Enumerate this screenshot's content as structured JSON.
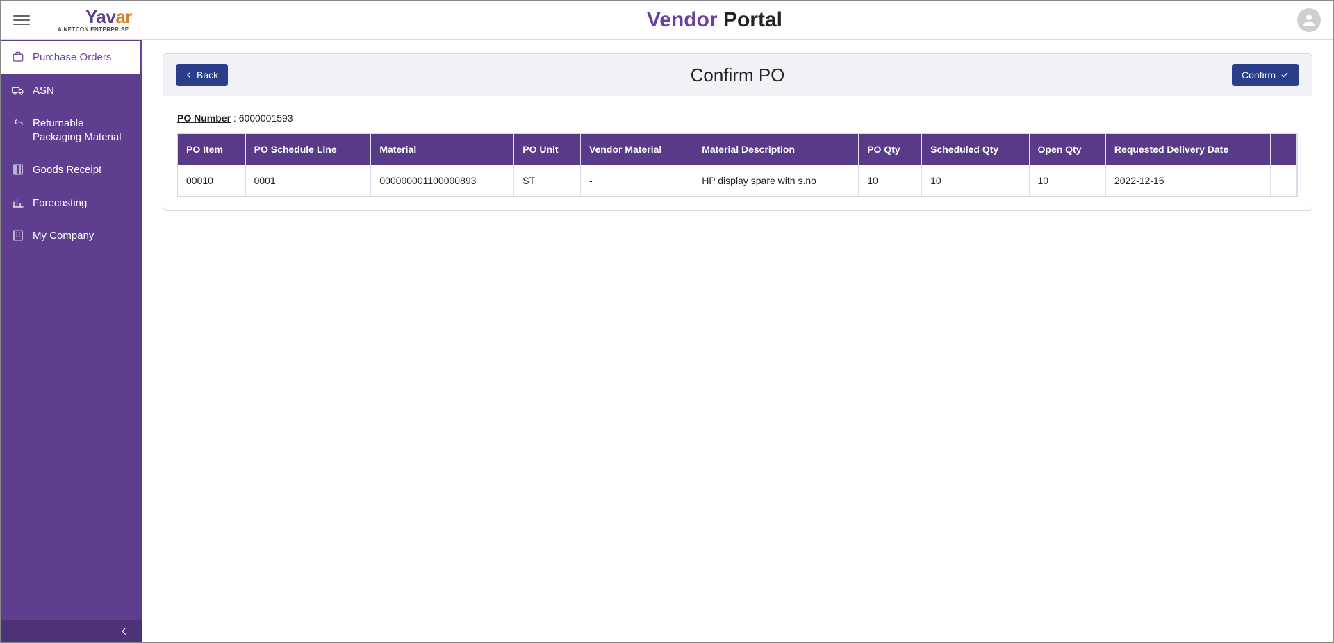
{
  "header": {
    "logo_main": "Yavar",
    "logo_sub": "A NETCON ENTERPRISE",
    "title_accent": "Vendor",
    "title_plain": "Portal"
  },
  "sidebar": {
    "items": [
      {
        "label": "Purchase Orders",
        "icon": "briefcase-icon",
        "active": true
      },
      {
        "label": "ASN",
        "icon": "truck-icon",
        "active": false
      },
      {
        "label": "Returnable Packaging Material",
        "icon": "return-icon",
        "active": false
      },
      {
        "label": "Goods Receipt",
        "icon": "receipt-icon",
        "active": false
      },
      {
        "label": "Forecasting",
        "icon": "bar-chart-icon",
        "active": false
      },
      {
        "label": "My Company",
        "icon": "building-icon",
        "active": false
      }
    ]
  },
  "page": {
    "back_label": "Back",
    "title": "Confirm PO",
    "confirm_label": "Confirm",
    "po_number_label": "PO Number",
    "po_number_value": "6000001593"
  },
  "table": {
    "columns": [
      "PO Item",
      "PO Schedule Line",
      "Material",
      "PO Unit",
      "Vendor Material",
      "Material Description",
      "PO Qty",
      "Scheduled Qty",
      "Open Qty",
      "Requested Delivery Date"
    ],
    "rows": [
      {
        "po_item": "00010",
        "po_schedule_line": "0001",
        "material": "000000001100000893",
        "po_unit": "ST",
        "vendor_material": "-",
        "material_description": "HP display spare with s.no",
        "po_qty": "10",
        "scheduled_qty": "10",
        "open_qty": "10",
        "requested_delivery_date": "2022-12-15"
      }
    ]
  }
}
